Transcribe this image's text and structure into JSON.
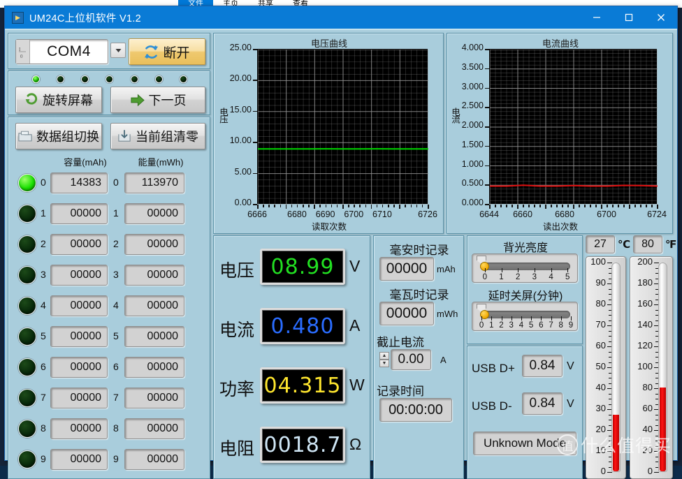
{
  "desktop": {
    "explorer_tabs": [
      "文件",
      "主页",
      "共享",
      "查看"
    ]
  },
  "window": {
    "title": "UM24C上位机软件 V1.2",
    "icon": "app-icon",
    "minimize": "—",
    "maximize": "▢",
    "close": "✕"
  },
  "connection": {
    "port_value": "COM4",
    "port_icon": "io-icon",
    "dropdown_icon": "chevron-down-icon",
    "disconnect_label": "断开",
    "disconnect_icon": "refresh-icon"
  },
  "leds": {
    "states": [
      "on",
      "off",
      "off",
      "off",
      "off",
      "off",
      "off"
    ]
  },
  "screen_buttons": {
    "rotate_label": "旋转屏幕",
    "rotate_icon": "rotate-icon",
    "next_page_label": "下一页",
    "next_page_icon": "arrow-right-icon"
  },
  "group_buttons": {
    "switch_label": "数据组切换",
    "switch_icon": "folder-icon",
    "clear_label": "当前组清零",
    "clear_icon": "save-icon"
  },
  "groups": {
    "capacity_header": "容量(mAh)",
    "energy_header": "能量(mWh)",
    "rows": [
      {
        "index": "0",
        "led": "on",
        "capacity": "14383",
        "energy": "113970"
      },
      {
        "index": "1",
        "led": "off",
        "capacity": "00000",
        "energy": "00000"
      },
      {
        "index": "2",
        "led": "off",
        "capacity": "00000",
        "energy": "00000"
      },
      {
        "index": "3",
        "led": "off",
        "capacity": "00000",
        "energy": "00000"
      },
      {
        "index": "4",
        "led": "off",
        "capacity": "00000",
        "energy": "00000"
      },
      {
        "index": "5",
        "led": "off",
        "capacity": "00000",
        "energy": "00000"
      },
      {
        "index": "6",
        "led": "off",
        "capacity": "00000",
        "energy": "00000"
      },
      {
        "index": "7",
        "led": "off",
        "capacity": "00000",
        "energy": "00000"
      },
      {
        "index": "8",
        "led": "off",
        "capacity": "00000",
        "energy": "00000"
      },
      {
        "index": "9",
        "led": "off",
        "capacity": "00000",
        "energy": "00000"
      }
    ]
  },
  "chart_data": [
    {
      "type": "line",
      "name": "voltage-chart",
      "title": "电压曲线",
      "ylabel": "电压",
      "xlabel": "读取次数",
      "ylim": [
        0.0,
        25.0
      ],
      "yticks": [
        "25.00",
        "20.00",
        "15.00",
        "10.00",
        "5.00",
        "0.00"
      ],
      "ytick_values": [
        25.0,
        20.0,
        15.0,
        10.0,
        5.0,
        0.0
      ],
      "xlim": [
        6666,
        6726
      ],
      "xticks": [
        "6666",
        "6680",
        "6690",
        "6700",
        "6710",
        "6726"
      ],
      "xtick_values": [
        6666,
        6680,
        6690,
        6700,
        6710,
        6726
      ],
      "grid": true,
      "plot_bg": "#000000",
      "grid_color": "#9a9a9a",
      "series": [
        {
          "name": "电压",
          "color": "#00d900",
          "x": [
            6666,
            6672,
            6678,
            6684,
            6690,
            6696,
            6702,
            6708,
            6714,
            6720,
            6726
          ],
          "values": [
            8.99,
            8.99,
            8.99,
            8.99,
            9.0,
            8.99,
            8.99,
            9.0,
            8.99,
            8.99,
            8.99
          ]
        }
      ]
    },
    {
      "type": "line",
      "name": "current-chart",
      "title": "电流曲线",
      "ylabel": "电流",
      "xlabel": "读出次数",
      "ylim": [
        0.0,
        4.0
      ],
      "yticks": [
        "4.000",
        "3.500",
        "3.000",
        "2.500",
        "2.000",
        "1.500",
        "1.000",
        "0.500",
        "0.000"
      ],
      "ytick_values": [
        4.0,
        3.5,
        3.0,
        2.5,
        2.0,
        1.5,
        1.0,
        0.5,
        0.0
      ],
      "xlim": [
        6644,
        6724
      ],
      "xticks": [
        "6644",
        "6660",
        "6680",
        "6700",
        "6724"
      ],
      "xtick_values": [
        6644,
        6660,
        6680,
        6700,
        6724
      ],
      "grid": true,
      "plot_bg": "#000000",
      "grid_color": "#9a9a9a",
      "series": [
        {
          "name": "电流",
          "color": "#e01010",
          "x": [
            6644,
            6652,
            6660,
            6668,
            6676,
            6684,
            6692,
            6700,
            6708,
            6716,
            6724
          ],
          "values": [
            0.478,
            0.478,
            0.5,
            0.478,
            0.478,
            0.49,
            0.478,
            0.478,
            0.495,
            0.49,
            0.478
          ]
        }
      ]
    }
  ],
  "readouts": [
    {
      "label": "电压",
      "value": "08.99",
      "unit": "V",
      "color": "#22e022"
    },
    {
      "label": "电流",
      "value": "0.480",
      "unit": "A",
      "color": "#2a6cff"
    },
    {
      "label": "功率",
      "value": "04.315",
      "unit": "W",
      "color": "#ffe62e"
    },
    {
      "label": "电阻",
      "value": "0018.7",
      "unit": "Ω",
      "color": "#cfe6f5"
    }
  ],
  "records": {
    "mah_label": "毫安时记录",
    "mah_value": "00000",
    "mah_unit": "mAh",
    "mwh_label": "毫瓦时记录",
    "mwh_value": "00000",
    "mwh_unit": "mWh",
    "cutoff_label": "截止电流",
    "cutoff_value": "0.00",
    "cutoff_unit": "A",
    "cutoff_up_icon": "spinner-up-icon",
    "cutoff_down_icon": "spinner-down-icon",
    "time_label": "记录时间",
    "time_value": "00:00:00"
  },
  "settings": {
    "backlight_label": "背光亮度",
    "backlight_ticks": [
      "0",
      "1",
      "2",
      "3",
      "4",
      "5"
    ],
    "backlight_value": 0,
    "sleep_label": "延时关屏(分钟)",
    "sleep_ticks": [
      "0",
      "1",
      "2",
      "3",
      "4",
      "5",
      "6",
      "7",
      "8",
      "9"
    ],
    "sleep_value": 0
  },
  "usb": {
    "dplus_label": "USB D+",
    "dplus_value": "0.84",
    "dplus_unit": "V",
    "dminus_label": "USB D-",
    "dminus_value": "0.84",
    "dminus_unit": "V",
    "mode_label": "Unknown Mode"
  },
  "temperature": {
    "celsius_value": "27",
    "celsius_unit": "℃",
    "fahrenheit_value": "80",
    "fahrenheit_unit": "℉",
    "celsius_scale": [
      "100",
      "90",
      "80",
      "70",
      "60",
      "50",
      "40",
      "30",
      "20",
      "10",
      "0"
    ],
    "celsius_max": 100,
    "celsius_reading": 27,
    "fahrenheit_scale": [
      "200",
      "180",
      "160",
      "140",
      "120",
      "100",
      "80",
      "60",
      "40",
      "20",
      "0"
    ],
    "fahrenheit_max": 200,
    "fahrenheit_reading": 80
  },
  "watermark": {
    "logo": "值",
    "text": "什么值得买"
  }
}
